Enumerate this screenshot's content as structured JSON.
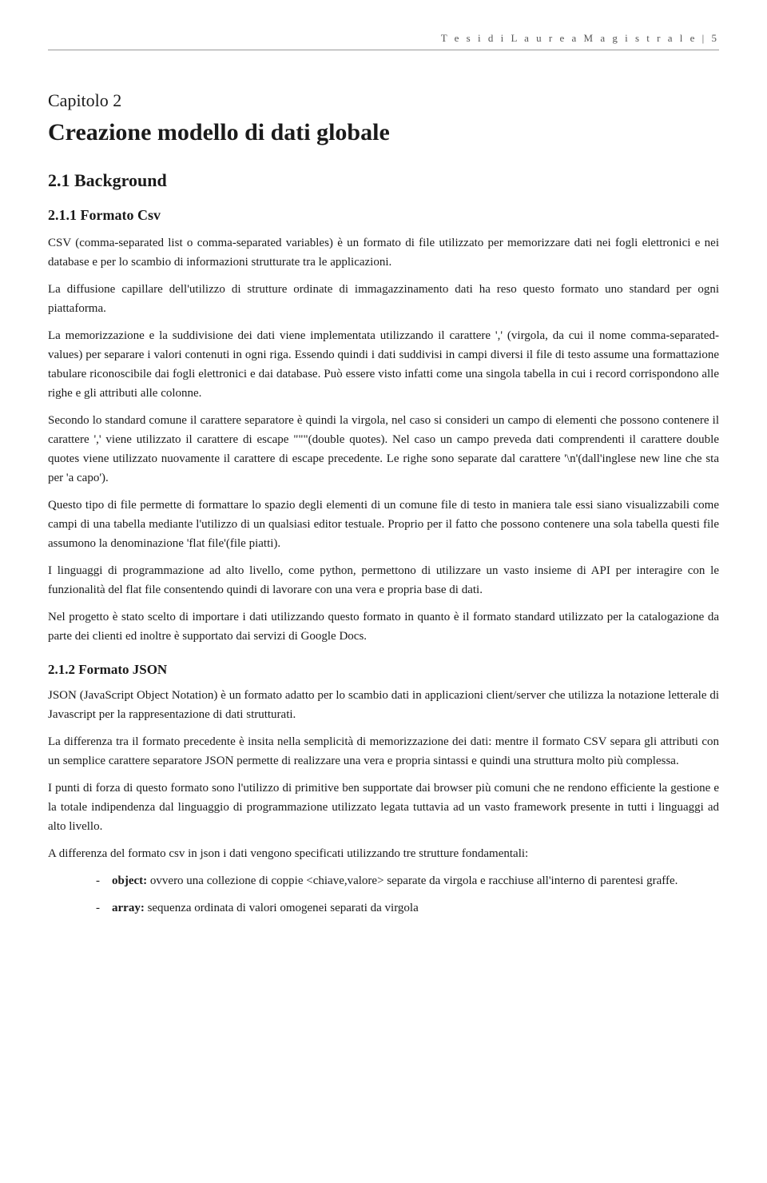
{
  "header": {
    "text": "T e s i   d i   L a u r e a   M a g i s t r a l e  | 5"
  },
  "chapter": {
    "label": "Capitolo 2",
    "title": "Creazione modello di dati globale"
  },
  "section_21": {
    "title": "2.1 Background"
  },
  "subsection_211": {
    "title": "2.1.1 Formato Csv",
    "paragraphs": [
      "CSV (comma-separated list o comma-separated variables) è un formato di file utilizzato per memorizzare dati nei fogli elettronici e nei database e per lo scambio di informazioni strutturate tra le applicazioni.",
      "La diffusione capillare dell'utilizzo di strutture ordinate di immagazzinamento dati ha reso questo formato uno standard per ogni piattaforma.",
      "La memorizzazione e la suddivisione dei dati viene implementata utilizzando il carattere ',' (virgola, da cui il nome comma-separated-values) per separare i valori contenuti in ogni riga. Essendo quindi i dati suddivisi in campi diversi il file di testo assume una formattazione tabulare riconoscibile dai fogli elettronici e dai database. Può essere visto infatti come una singola tabella in cui i record corrispondono alle righe e gli attributi alle colonne.",
      "Secondo lo standard comune il carattere separatore è quindi la virgola, nel caso si consideri un campo di elementi che possono contenere il carattere ',' viene utilizzato il carattere di escape \"\"\"(double quotes). Nel caso un campo preveda dati comprendenti il carattere double quotes viene utilizzato nuovamente il carattere di escape precedente. Le righe sono separate dal carattere '\\n'(dall'inglese new line che sta per 'a capo').",
      "Questo tipo di file permette di formattare lo spazio degli elementi di un comune file di testo in maniera tale essi siano visualizzabili come campi di una tabella mediante l'utilizzo di un qualsiasi editor testuale. Proprio per il fatto che possono contenere una sola tabella questi file assumono la denominazione 'flat file'(file piatti).",
      "I linguaggi di programmazione ad alto livello, come python, permettono di utilizzare un vasto insieme di API per interagire con le funzionalità del flat file consentendo quindi di lavorare con una vera e propria base di dati.",
      "Nel progetto è stato scelto di importare i dati utilizzando questo formato in quanto è il formato standard utilizzato per la catalogazione da parte dei clienti ed inoltre è supportato dai servizi di Google Docs."
    ]
  },
  "subsection_212": {
    "title": "2.1.2 Formato JSON",
    "paragraphs": [
      "JSON (JavaScript Object Notation) è un formato adatto per lo scambio dati in applicazioni client/server che utilizza la notazione letterale di Javascript per la rappresentazione di dati strutturati.",
      "La differenza tra il formato precedente è insita nella semplicità di memorizzazione dei dati: mentre il formato CSV separa gli attributi con un semplice carattere separatore JSON permette di realizzare una vera e propria sintassi e quindi una struttura molto più complessa.",
      "I punti di forza di questo formato sono l'utilizzo di primitive ben supportate dai browser più comuni che ne rendono efficiente la gestione e la totale indipendenza dal linguaggio di programmazione utilizzato legata tuttavia ad un vasto framework presente in tutti i linguaggi ad alto livello.",
      "A differenza del formato csv in json i dati vengono specificati utilizzando tre strutture fondamentali:"
    ],
    "list": [
      {
        "bold": "object:",
        "text": " ovvero una collezione di coppie <chiave,valore> separate da virgola e racchiuse all'interno di parentesi graffe."
      },
      {
        "bold": "array:",
        "text": " sequenza ordinata di valori omogenei separati da virgola"
      }
    ]
  }
}
